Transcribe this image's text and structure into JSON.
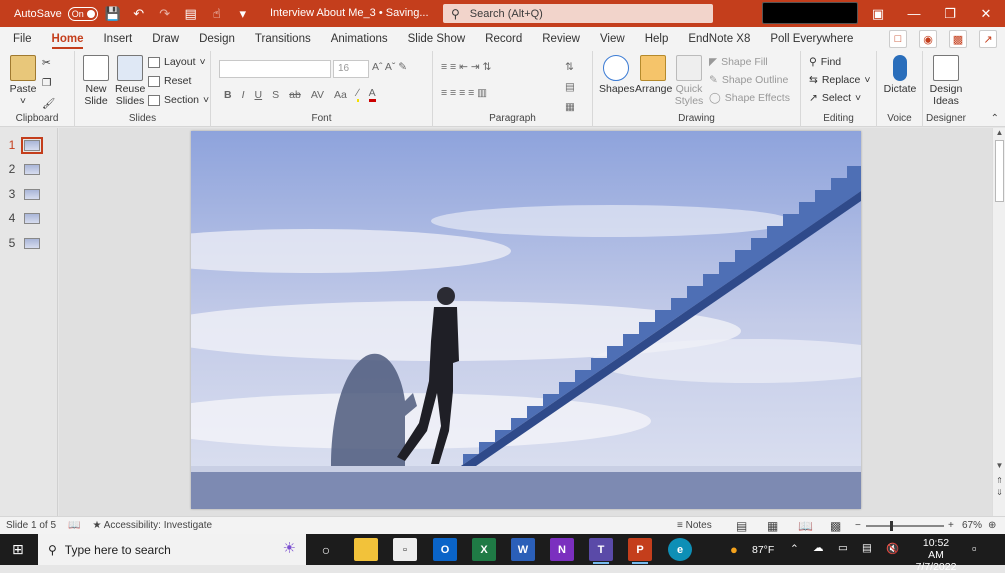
{
  "titlebar": {
    "autosave_label": "AutoSave",
    "autosave_state": "On",
    "doc_title": "Interview About Me_3 • Saving...",
    "search_placeholder": "Search (Alt+Q)"
  },
  "menu": {
    "tabs": [
      "File",
      "Home",
      "Insert",
      "Draw",
      "Design",
      "Transitions",
      "Animations",
      "Slide Show",
      "Record",
      "Review",
      "View",
      "Help",
      "EndNote X8",
      "Poll Everywhere"
    ],
    "active_tab": "Home"
  },
  "ribbon": {
    "clipboard": {
      "paste": "Paste",
      "label": "Clipboard"
    },
    "slides": {
      "new_slide_1": "New",
      "new_slide_2": "Slide",
      "reuse_1": "Reuse",
      "reuse_2": "Slides",
      "layout": "Layout",
      "reset": "Reset",
      "section": "Section",
      "label": "Slides"
    },
    "font": {
      "size": "16",
      "label": "Font"
    },
    "paragraph": {
      "label": "Paragraph"
    },
    "drawing": {
      "shapes": "Shapes",
      "arrange": "Arrange",
      "quick_1": "Quick",
      "quick_2": "Styles",
      "shape_fill": "Shape Fill",
      "shape_outline": "Shape Outline",
      "shape_effects": "Shape Effects",
      "label": "Drawing"
    },
    "editing": {
      "find": "Find",
      "replace": "Replace",
      "select": "Select",
      "label": "Editing"
    },
    "voice": {
      "dictate": "Dictate",
      "label": "Voice"
    },
    "designer": {
      "ideas_1": "Design",
      "ideas_2": "Ideas",
      "label": "Designer"
    }
  },
  "slides_panel": {
    "numbers": [
      "1",
      "2",
      "3",
      "4",
      "5"
    ],
    "selected": "1"
  },
  "status": {
    "slide_info": "Slide 1 of 5",
    "accessibility": "Accessibility: Investigate",
    "notes": "Notes",
    "zoom": "67%"
  },
  "taskbar": {
    "search_placeholder": "Type here to search",
    "temperature": "87°F",
    "time": "10:52 AM",
    "date": "7/7/2022"
  },
  "colors": {
    "accent": "#c43e1c",
    "taskbar": "#1c1c1c",
    "ribbon": "#f3f3f3"
  }
}
